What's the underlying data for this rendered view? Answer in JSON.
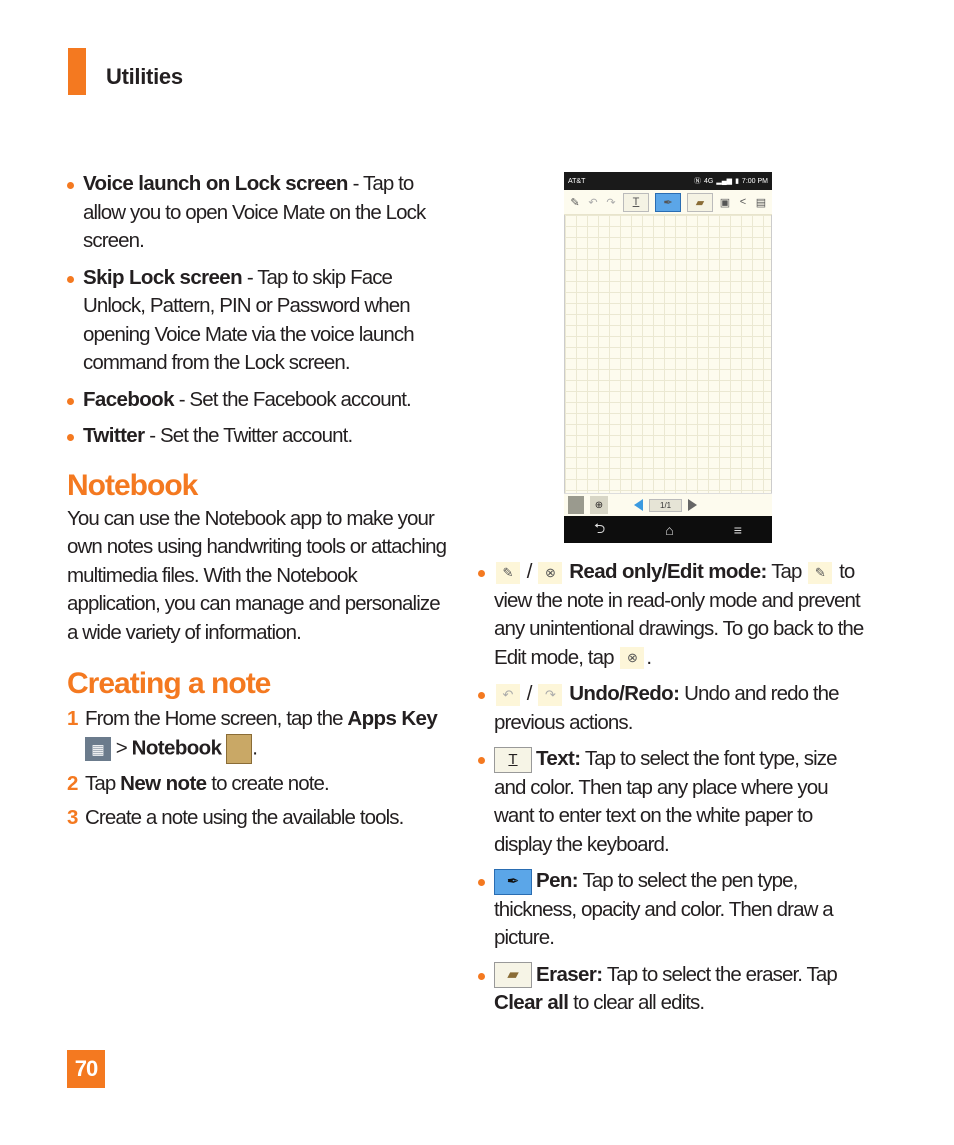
{
  "header": {
    "section": "Utilities",
    "accent": "#f47920"
  },
  "left": {
    "bullets": [
      {
        "term": "Voice launch on Lock screen",
        "desc": " - Tap to allow you to open Voice Mate on the Lock screen."
      },
      {
        "term": "Skip Lock screen",
        "desc": " - Tap to skip Face Unlock, Pattern, PIN or Password when opening Voice Mate via the voice launch command from the Lock screen."
      },
      {
        "term": "Facebook",
        "desc": " - Set the Facebook account."
      },
      {
        "term": "Twitter",
        "desc": " - Set the Twitter account."
      }
    ],
    "notebook_heading": "Notebook",
    "notebook_body": "You can use the Notebook app to make your own notes using handwriting tools or attaching multimedia files. With the Notebook application, you can manage and personalize a wide variety of information.",
    "creating_heading": "Creating a note",
    "steps": [
      {
        "num": "1",
        "pre": "From the Home screen, tap the ",
        "b1": "Apps Key",
        "mid": " > ",
        "b2": "Notebook",
        "post": "."
      },
      {
        "num": "2",
        "pre": "Tap ",
        "b1": "New note",
        "post": " to create note."
      },
      {
        "num": "3",
        "pre": "Create a note using the available tools."
      }
    ]
  },
  "phone": {
    "carrier": "AT&T",
    "time": "7:00 PM",
    "page_indicator": "1/1",
    "toolbar_icons": [
      "edit-mode-icon",
      "undo-icon",
      "redo-icon",
      "text-tool-icon",
      "pen-tool-icon",
      "eraser-tool-icon",
      "insert-image-icon",
      "share-icon",
      "save-icon"
    ],
    "nav_icons": [
      "back-icon",
      "home-icon",
      "menu-icon"
    ]
  },
  "right": {
    "items": [
      {
        "term": "Read only/Edit mode:",
        "desc1": " Tap ",
        "desc2": " to view the note in read-only mode and prevent any unintentional drawings. To go back to the Edit mode, tap ",
        "end": "."
      },
      {
        "term": "Undo/Redo:",
        "desc": " Undo and redo the previous actions."
      },
      {
        "term": "Text:",
        "desc": " Tap to select the font type, size and color. Then tap any place where you want to enter text on the white paper to display the keyboard."
      },
      {
        "term": "Pen:",
        "desc": " Tap to select the pen type, thickness, opacity and color. Then draw a picture."
      },
      {
        "term": "Eraser:",
        "desc": " Tap to select the eraser. Tap ",
        "b2": "Clear all",
        "desc2": " to clear all edits."
      }
    ],
    "separator": " / "
  },
  "footer": {
    "page_number": "70"
  }
}
